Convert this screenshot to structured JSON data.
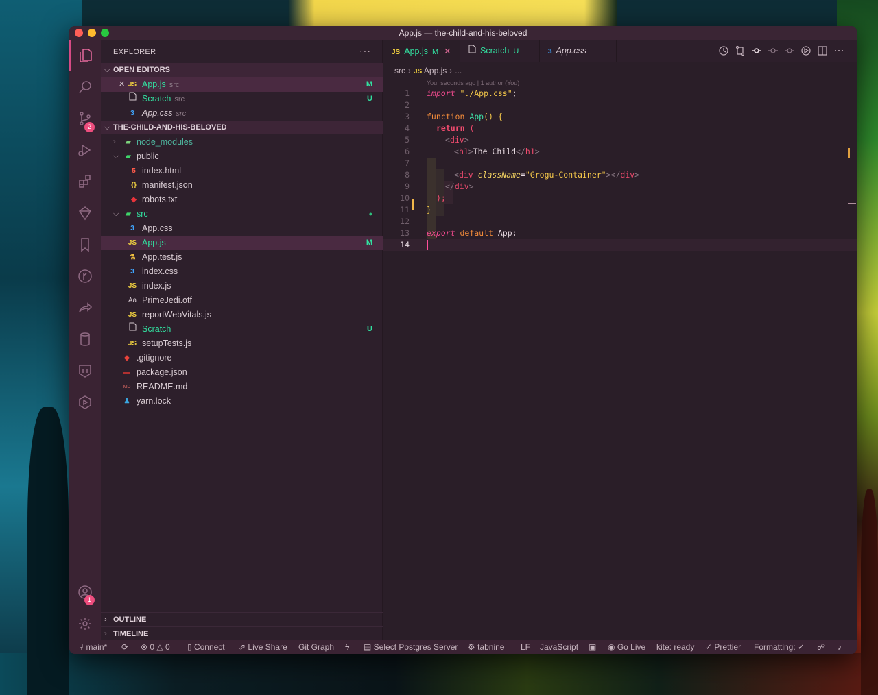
{
  "window": {
    "title": "App.js — the-child-and-his-beloved"
  },
  "activity": {
    "items": [
      {
        "name": "explorer-icon"
      },
      {
        "name": "search-icon"
      },
      {
        "name": "source-control-icon",
        "badge": "2"
      },
      {
        "name": "run-debug-icon"
      },
      {
        "name": "extensions-icon"
      },
      {
        "name": "remote-icon"
      },
      {
        "name": "bookmark-icon"
      },
      {
        "name": "git-graph-icon"
      },
      {
        "name": "live-share-icon"
      },
      {
        "name": "database-icon"
      },
      {
        "name": "docker-icon"
      },
      {
        "name": "cube-icon"
      }
    ],
    "account_badge": "1"
  },
  "sidebar": {
    "title": "EXPLORER",
    "more": "···",
    "open_editors_label": "OPEN EDITORS",
    "open_editors": [
      {
        "icon": "JS",
        "label": "App.js",
        "sub": "src",
        "git": "M",
        "close": "✕"
      },
      {
        "icon": "file-icon",
        "label": "Scratch",
        "sub": "src",
        "git": "U"
      },
      {
        "icon": "css-icon",
        "label": "App.css",
        "sub": "src",
        "git": ""
      }
    ],
    "project_label": "THE-CHILD-AND-HIS-BELOVED",
    "tree": [
      {
        "label": "node_modules",
        "git": ""
      },
      {
        "label": "public",
        "git": ""
      },
      {
        "label": "index.html",
        "git": ""
      },
      {
        "label": "manifest.json",
        "git": ""
      },
      {
        "label": "robots.txt",
        "git": ""
      },
      {
        "label": "src",
        "git": "●"
      },
      {
        "label": "App.css",
        "git": ""
      },
      {
        "label": "App.js",
        "git": "M"
      },
      {
        "label": "App.test.js",
        "git": ""
      },
      {
        "label": "index.css",
        "git": ""
      },
      {
        "label": "index.js",
        "git": ""
      },
      {
        "label": "PrimeJedi.otf",
        "git": ""
      },
      {
        "label": "reportWebVitals.js",
        "git": ""
      },
      {
        "label": "Scratch",
        "git": "U"
      },
      {
        "label": "setupTests.js",
        "git": ""
      },
      {
        "label": ".gitignore",
        "git": ""
      },
      {
        "label": "package.json",
        "git": ""
      },
      {
        "label": "README.md",
        "git": ""
      },
      {
        "label": "yarn.lock",
        "git": ""
      }
    ],
    "outline_label": "OUTLINE",
    "timeline_label": "TIMELINE"
  },
  "editor": {
    "tabs": [
      {
        "icon": "JS",
        "label": "App.js",
        "status": "M",
        "close": "✕"
      },
      {
        "icon": "file-icon",
        "label": "Scratch",
        "status": "U"
      },
      {
        "icon": "css-icon",
        "label": "App.css",
        "status": ""
      }
    ],
    "breadcrumb": {
      "folder": "src",
      "icon": "JS",
      "file": "App.js",
      "tail": "..."
    },
    "blame": "You, seconds ago | 1 author (You)",
    "line_numbers": [
      "1",
      "2",
      "3",
      "4",
      "5",
      "6",
      "7",
      "8",
      "9",
      "10",
      "11",
      "12",
      "13",
      "14"
    ],
    "code": {
      "l1_kw": "import",
      "l1_str": "\"./App.css\"",
      "l1_end": ";",
      "l3_kw": "function",
      "l3_fn": "App",
      "l3_rest": "() {",
      "l4_kw": "return",
      "l4_rest": " (",
      "l5_open": "<",
      "l5_tag": "div",
      "l5_close": ">",
      "l6_open": "<",
      "l6_tag": "h1",
      "l6_close": ">",
      "l6_text": "The Child",
      "l6_eopen": "</",
      "l6_etag": "h1",
      "l6_eclose": ">",
      "l8_open": "<",
      "l8_tag": "div",
      "l8_attr": "className",
      "l8_eq": "=",
      "l8_str": "\"Grogu-Container\"",
      "l8_close": "></",
      "l8_etag": "div",
      "l8_eclose": ">",
      "l9_open": "</",
      "l9_tag": "div",
      "l9_close": ">",
      "l10": ");",
      "l11": "}",
      "l13_kw": "export",
      "l13_kw2": "default",
      "l13_rest": " App;"
    }
  },
  "statusbar": {
    "branch": "main*",
    "errors": "0",
    "warnings": "0",
    "connect": "Connect",
    "live_share": "Live Share",
    "git_graph": "Git Graph",
    "postgres": "Select Postgres Server",
    "tabnine": "tabnine",
    "eol": "LF",
    "language": "JavaScript",
    "go_live": "Go Live",
    "kite": "kite: ready",
    "prettier": "Prettier",
    "formatting": "Formatting: ✓"
  }
}
